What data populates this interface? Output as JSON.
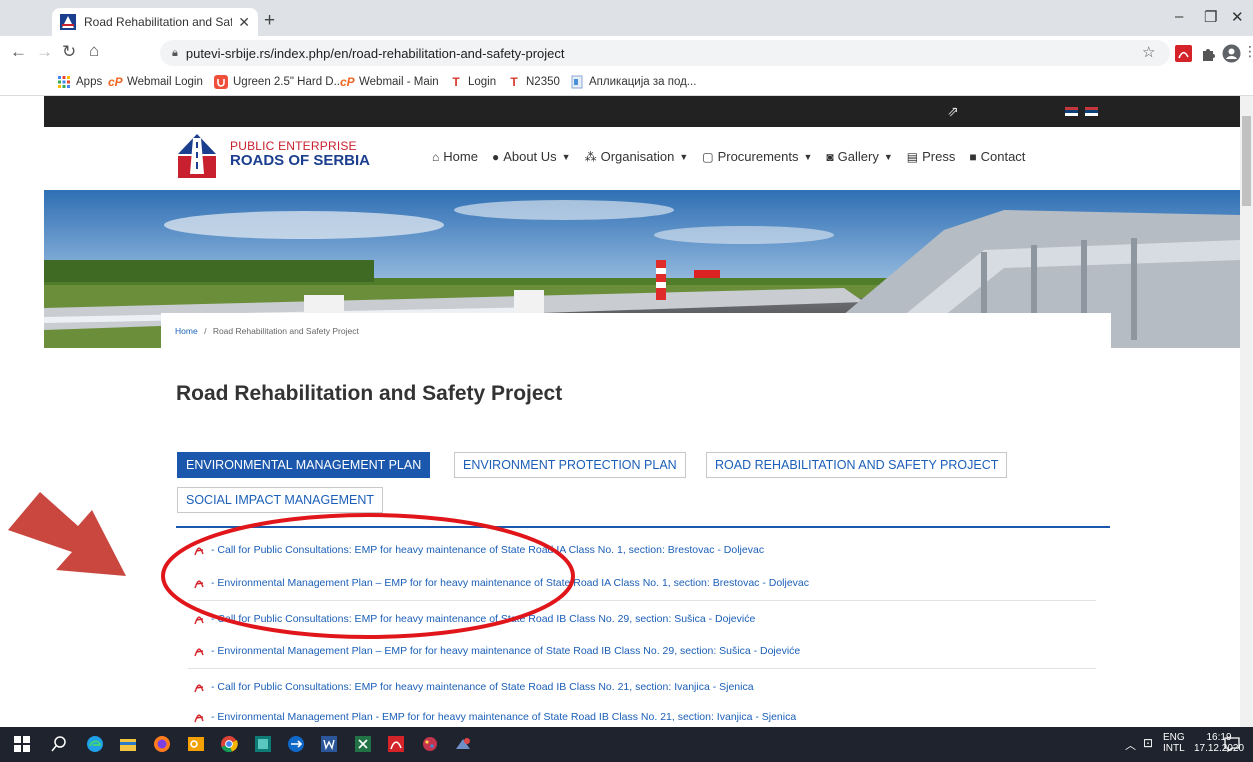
{
  "browser": {
    "tab_title": "Road Rehabilitation and Safety P",
    "tab_close": "✕",
    "new_tab": "+",
    "url": "putevi-srbije.rs/index.php/en/road-rehabilitation-and-safety-project",
    "window_controls": [
      "–",
      "❐",
      "✕"
    ],
    "bookmarks": [
      {
        "label": "Apps",
        "icon": "apps-grid-icon"
      },
      {
        "label": "Webmail Login",
        "icon": "cp-icon"
      },
      {
        "label": "Ugreen 2.5\" Hard D...",
        "icon": "ugreen-icon"
      },
      {
        "label": "Webmail - Main",
        "icon": "cp-icon"
      },
      {
        "label": "Login",
        "icon": "t-icon"
      },
      {
        "label": "N2350",
        "icon": "t-icon"
      },
      {
        "label": "Апликација за под...",
        "icon": "doc-icon"
      }
    ]
  },
  "site": {
    "brand_line1": "PUBLIC ENTERPRISE",
    "brand_line2": "ROADS OF SERBIA",
    "nav": [
      {
        "label": "Home",
        "icon": "home-icon",
        "dropdown": false
      },
      {
        "label": "About Us",
        "icon": "user-icon",
        "dropdown": true
      },
      {
        "label": "Organisation",
        "icon": "sitemap-icon",
        "dropdown": true
      },
      {
        "label": "Procurements",
        "icon": "clipboard-icon",
        "dropdown": true
      },
      {
        "label": "Gallery",
        "icon": "camera-icon",
        "dropdown": true
      },
      {
        "label": "Press",
        "icon": "newspaper-icon",
        "dropdown": false
      },
      {
        "label": "Contact",
        "icon": "contact-book-icon",
        "dropdown": false
      }
    ],
    "breadcrumb": {
      "home": "Home",
      "separator": "/",
      "current": "Road Rehabilitation and Safety Project"
    },
    "page_title": "Road Rehabilitation and Safety Project",
    "tabs": [
      {
        "label": "ENVIRONMENTAL MANAGEMENT PLAN",
        "active": true
      },
      {
        "label": "ENVIRONMENT PROTECTION PLAN",
        "active": false
      },
      {
        "label": "ROAD REHABILITATION AND SAFETY PROJECT",
        "active": false
      },
      {
        "label": "SOCIAL IMPACT MANAGEMENT",
        "active": false
      }
    ],
    "documents": [
      "- Call for Public Consultations: EMP for heavy maintenance of State Road IA Class No. 1, section: Brestovac - Doljevac",
      "- Environmental Management Plan – EMP for for heavy maintenance of State Road IA Class No. 1, section: Brestovac - Doljevac",
      "- Call for Public Consultations: EMP for heavy maintenance of State Road IB Class No. 29, section: Sušica - Dojeviće",
      "- Environmental Management Plan – EMP for for heavy maintenance of State Road IB Class No. 29, section: Sušica - Dojeviće",
      "- Call for Public Consultations: EMP for heavy maintenance of State Road IB Class No. 21, section: Ivanjica - Sjenica",
      "- Environmental Management Plan - EMP for for heavy maintenance of State Road IB Class No. 21, section: Ivanjica - Sjenica"
    ]
  },
  "taskbar": {
    "lang_top": "ENG",
    "lang_bottom": "INTL",
    "time": "16:19",
    "date": "17.12.2020"
  },
  "colors": {
    "accent_blue": "#1b58ad",
    "annotation_red": "#e0161b",
    "arrow_red": "#c9473f"
  }
}
